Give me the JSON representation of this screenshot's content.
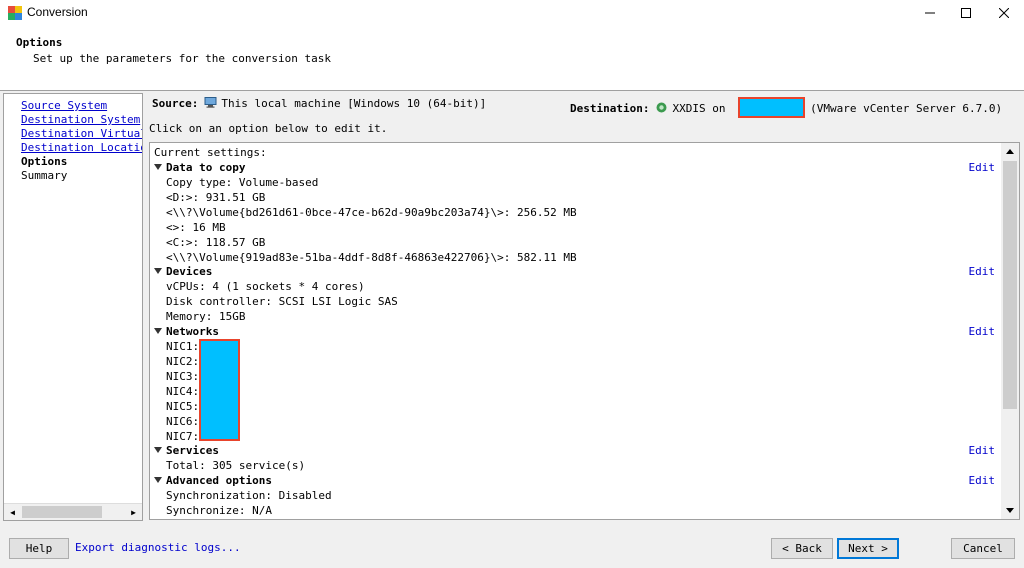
{
  "window": {
    "title": "Conversion",
    "minimize_icon": "minimize-icon",
    "maximize_icon": "maximize-icon",
    "close_icon": "close-icon"
  },
  "header": {
    "title": "Options",
    "subtitle": "Set up the parameters for the conversion task"
  },
  "nav": {
    "items": [
      {
        "label": "Source System",
        "state": "link"
      },
      {
        "label": "Destination System",
        "state": "link"
      },
      {
        "label": "Destination Virtual Machine",
        "state": "link"
      },
      {
        "label": "Destination Location",
        "state": "link"
      },
      {
        "label": "Options",
        "state": "active"
      },
      {
        "label": "Summary",
        "state": "pending"
      }
    ]
  },
  "source": {
    "label": "Source:",
    "icon": "computer-icon",
    "value": "This local machine [Windows 10 (64-bit)]"
  },
  "destination": {
    "label": "Destination:",
    "icon": "vcenter-icon",
    "vm_name": "XXDIS on",
    "server_info": "(VMware vCenter Server 6.7.0)"
  },
  "hint": "Click on an option below to edit it.",
  "settings": {
    "heading": "Current settings:",
    "edit_label": "Edit",
    "data_to_copy": {
      "title": "Data to copy",
      "lines": [
        "Copy type: Volume-based",
        "<D:>: 931.51 GB",
        "<\\\\?\\Volume{bd261d61-0bce-47ce-b62d-90a9bc203a74}\\>: 256.52 MB",
        "<>: 16 MB",
        "<C:>: 118.57 GB",
        "<\\\\?\\Volume{919ad83e-51ba-4ddf-8d8f-46863e422706}\\>: 582.11 MB"
      ]
    },
    "devices": {
      "title": "Devices",
      "lines": [
        "vCPUs: 4 (1 sockets * 4 cores)",
        "Disk controller: SCSI LSI Logic SAS",
        "Memory: 15GB"
      ]
    },
    "networks": {
      "title": "Networks",
      "lines": [
        "NIC1:",
        "NIC2:",
        "NIC3:",
        "NIC4:",
        "NIC5:",
        "NIC6:",
        "NIC7:"
      ]
    },
    "services": {
      "title": "Services",
      "lines": [
        "Total: 305 service(s)"
      ]
    },
    "advanced": {
      "title": "Advanced options",
      "lines": [
        "Synchronization: Disabled",
        "Synchronize: N/A"
      ]
    }
  },
  "footer": {
    "help": "Help",
    "export": "Export diagnostic logs...",
    "back": "< Back",
    "next": "Next >",
    "cancel": "Cancel"
  },
  "colors": {
    "redaction_fill": "#00bfff",
    "redaction_border": "#e8442c",
    "link": "#0000cc"
  }
}
